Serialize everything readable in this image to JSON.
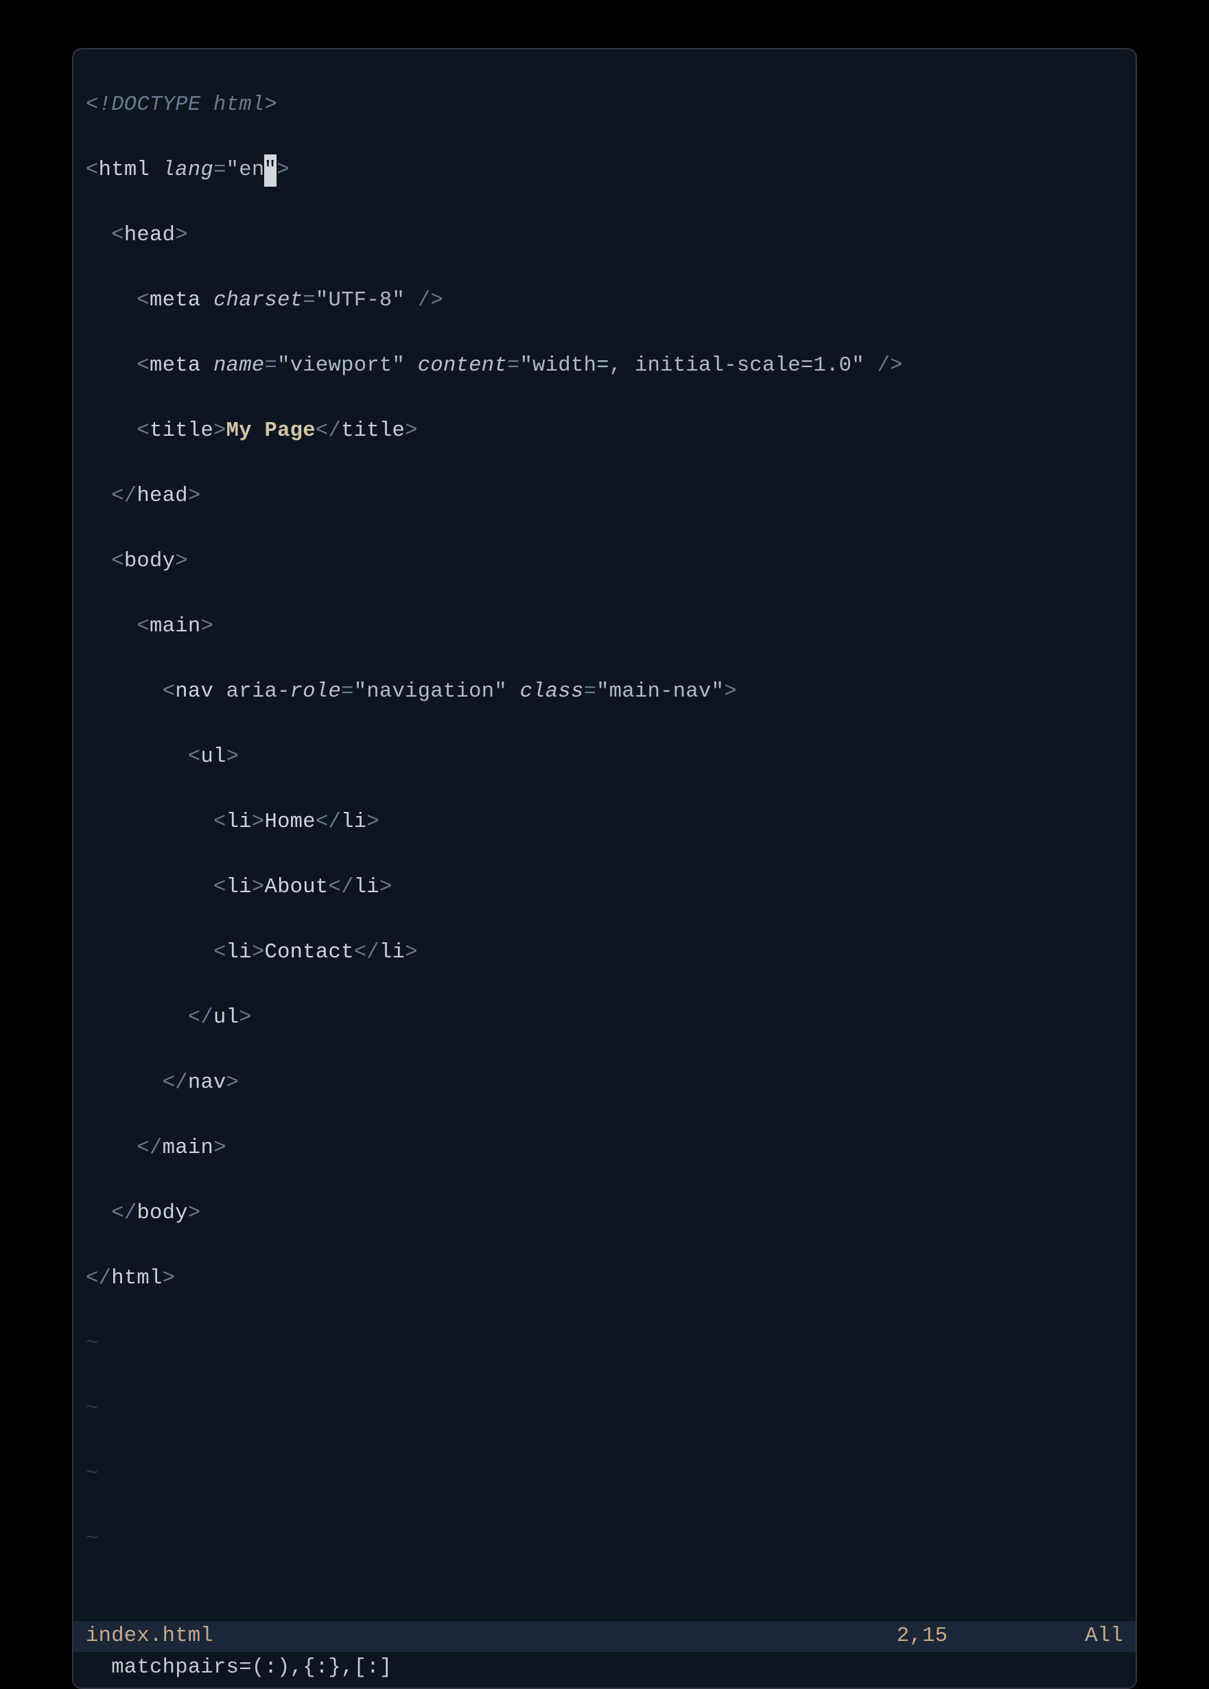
{
  "code": {
    "l1": {
      "doctype": "<!DOCTYPE html>"
    },
    "l2": {
      "open": "<",
      "tag": "html",
      "sp": " ",
      "attr": "lang",
      "eq": "=",
      "q1": "\"",
      "val": "en",
      "qcur": "\"",
      "close": ">"
    },
    "l3": {
      "indent": "  ",
      "open": "<",
      "tag": "head",
      "close": ">"
    },
    "l4": {
      "indent": "    ",
      "open": "<",
      "tag": "meta",
      "sp": " ",
      "attr": "charset",
      "eq": "=",
      "val": "\"UTF-8\"",
      "sp2": " ",
      "slash": "/>"
    },
    "l5": {
      "indent": "    ",
      "open": "<",
      "tag": "meta",
      "sp": " ",
      "a1": "name",
      "eq1": "=",
      "v1": "\"viewport\"",
      "sp2": " ",
      "a2": "content",
      "eq2": "=",
      "v2": "\"width=, initial-scale=1.0\"",
      "sp3": " ",
      "slash": "/>"
    },
    "l6": {
      "indent": "    ",
      "open": "<",
      "tag": "title",
      "close": ">",
      "text": "My Page",
      "open2": "</",
      "tag2": "title",
      "close2": ">"
    },
    "l7": {
      "indent": "  ",
      "open": "</",
      "tag": "head",
      "close": ">"
    },
    "l8": {
      "indent": "  ",
      "open": "<",
      "tag": "body",
      "close": ">"
    },
    "l9": {
      "indent": "    ",
      "open": "<",
      "tag": "main",
      "close": ">"
    },
    "l10": {
      "indent": "      ",
      "open": "<",
      "tag": "nav",
      "sp": " ",
      "a1p": "aria-",
      "a1": "role",
      "eq1": "=",
      "v1": "\"navigation\"",
      "sp2": " ",
      "a2": "class",
      "eq2": "=",
      "v2": "\"main-nav\"",
      "close": ">"
    },
    "l11": {
      "indent": "        ",
      "open": "<",
      "tag": "ul",
      "close": ">"
    },
    "l12": {
      "indent": "          ",
      "open": "<",
      "tag": "li",
      "close": ">",
      "text": "Home",
      "open2": "</",
      "tag2": "li",
      "close2": ">"
    },
    "l13": {
      "indent": "          ",
      "open": "<",
      "tag": "li",
      "close": ">",
      "text": "About",
      "open2": "</",
      "tag2": "li",
      "close2": ">"
    },
    "l14": {
      "indent": "          ",
      "open": "<",
      "tag": "li",
      "close": ">",
      "text": "Contact",
      "open2": "</",
      "tag2": "li",
      "close2": ">"
    },
    "l15": {
      "indent": "        ",
      "open": "</",
      "tag": "ul",
      "close": ">"
    },
    "l16": {
      "indent": "      ",
      "open": "</",
      "tag": "nav",
      "close": ">"
    },
    "l17": {
      "indent": "    ",
      "open": "</",
      "tag": "main",
      "close": ">"
    },
    "l18": {
      "indent": "  ",
      "open": "</",
      "tag": "body",
      "close": ">"
    },
    "l19": {
      "open": "</",
      "tag": "html",
      "close": ">"
    },
    "tilde": "~"
  },
  "status": {
    "filename": "index.html",
    "position": "2,15",
    "scroll": "All"
  },
  "cmdline": "  matchpairs=(:),{:},[:]"
}
